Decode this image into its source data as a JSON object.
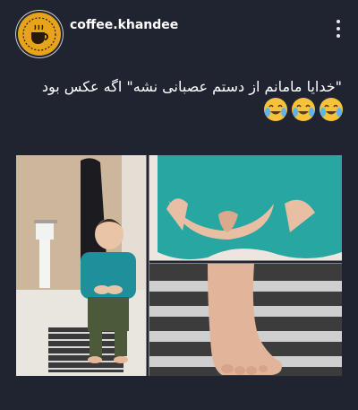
{
  "post": {
    "account": {
      "username": "coffee.khandee",
      "avatar_icon": "coffee-cup-logo-icon",
      "avatar_color": "#e7a41b"
    },
    "more_icon": "vertical-ellipsis-icon",
    "caption": "\"خدایا مامانم از دستم عصبانی نشه\" اگه عکس بود",
    "emojis": [
      "crying-laughing-emoji",
      "crying-laughing-emoji",
      "crying-laughing-emoji"
    ],
    "photo": {
      "panels": [
        "toddler-in-bathroom",
        "hands-closeup",
        "foot-closeup"
      ]
    }
  },
  "colors": {
    "background": "#1f2430",
    "text": "#ffffff",
    "accent": "#e7a41b"
  }
}
